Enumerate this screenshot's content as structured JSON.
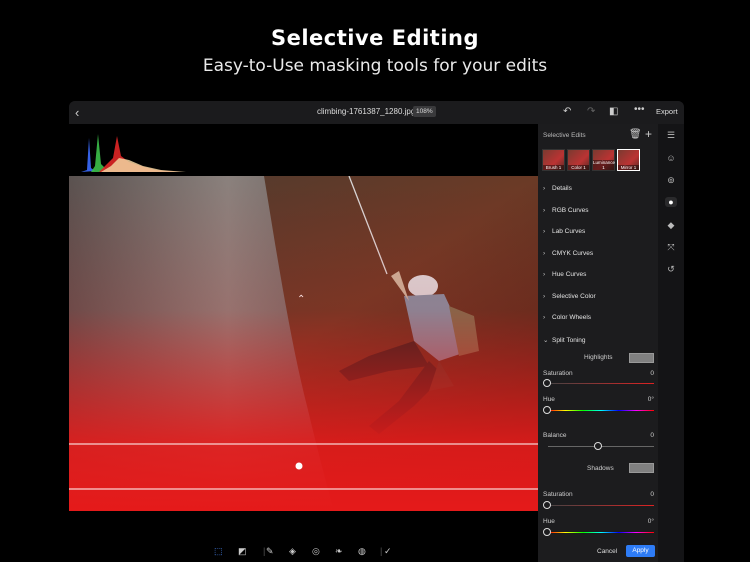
{
  "headline": "Selective Editing",
  "subline": "Easy-to-Use masking tools for your edits",
  "topbar": {
    "filename": "climbing-1761387_1280.jpg",
    "zoom": "108%",
    "export_label": "Export"
  },
  "panel": {
    "title": "Selective Edits",
    "thumbs": [
      "Brush 1",
      "Color 1",
      "Luminance 1",
      "Mirror 1"
    ],
    "sections": [
      "Details",
      "RGB Curves",
      "Lab Curves",
      "CMYK Curves",
      "Hue Curves",
      "Selective Color",
      "Color Wheels",
      "Split Toning"
    ],
    "split_toning": {
      "highlights_label": "Highlights",
      "saturation_label": "Saturation",
      "saturation_value": "0",
      "hue_label": "Hue",
      "hue_value": "0°",
      "balance_label": "Balance",
      "balance_value": "0",
      "shadows_label": "Shadows",
      "shadow_saturation_label": "Saturation",
      "shadow_saturation_value": "0",
      "shadow_hue_label": "Hue",
      "shadow_hue_value": "0°"
    },
    "cancel_label": "Cancel",
    "apply_label": "Apply"
  },
  "colors": {
    "accent": "#2e7cf6",
    "mask_red": "#e51a1a",
    "panel_bg": "#1c1c1e"
  },
  "icons": [
    "back-icon",
    "undo-icon",
    "redo-icon",
    "compare-icon",
    "more-icon",
    "trash-icon",
    "add-icon",
    "sliders-icon",
    "face-icon",
    "lens-icon",
    "mask-icon",
    "layers-icon",
    "transform-icon",
    "history-icon"
  ]
}
